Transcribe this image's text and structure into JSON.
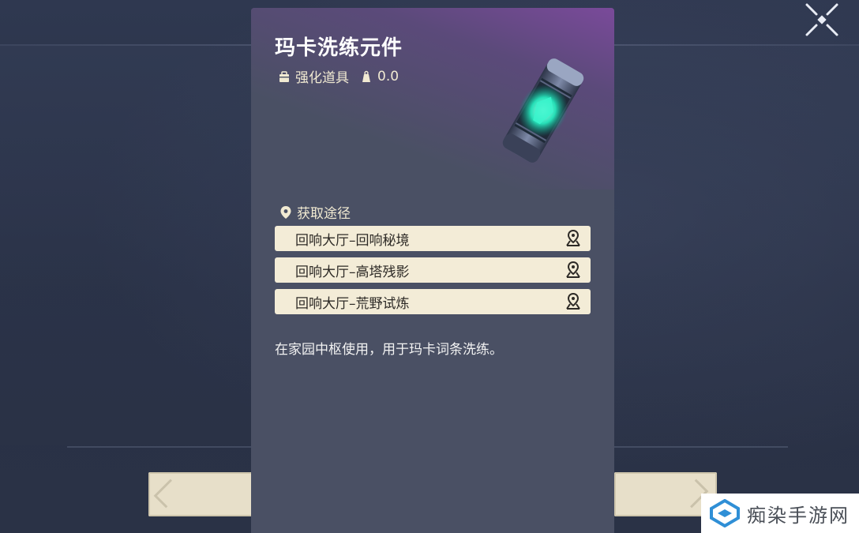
{
  "item": {
    "name": "玛卡洗练元件",
    "category": "强化道具",
    "weight": "0.0"
  },
  "obtain": {
    "heading": "获取途径",
    "routes": [
      {
        "label": "回响大厅–回响秘境"
      },
      {
        "label": "回响大厅–高塔残影"
      },
      {
        "label": "回响大厅–荒野试炼"
      }
    ]
  },
  "description": "在家园中枢使用，用于玛卡词条洗练。",
  "watermark": {
    "text": "痴染手游网"
  },
  "colors": {
    "card": "#4a5064",
    "header_accent": "#7a4a9a",
    "route_bg": "#f3ecd7",
    "meta_text": "#f1ead2"
  },
  "icons": {
    "close": "close-x-icon",
    "category": "bag-icon",
    "weight": "weight-icon",
    "location": "location-pin-icon",
    "navigate": "map-navigate-icon"
  }
}
